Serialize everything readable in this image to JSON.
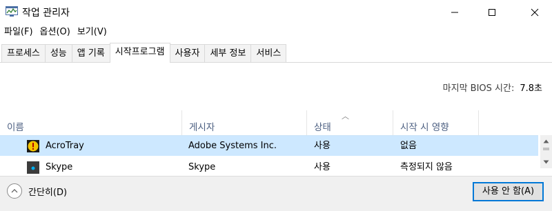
{
  "window": {
    "title": "작업 관리자"
  },
  "menu": {
    "file": "파일(F)",
    "options": "옵션(O)",
    "view": "보기(V)"
  },
  "tabs": [
    {
      "label": "프로세스"
    },
    {
      "label": "성능"
    },
    {
      "label": "앱 기록"
    },
    {
      "label": "시작프로그램",
      "active": true
    },
    {
      "label": "사용자"
    },
    {
      "label": "세부 정보"
    },
    {
      "label": "서비스"
    }
  ],
  "bios": {
    "label": "마지막 BIOS 시간:",
    "value": "7.8초"
  },
  "table": {
    "columns": [
      "이름",
      "게시자",
      "상태",
      "시작 시 영향"
    ],
    "sorted_column": "상태",
    "rows": [
      {
        "name": "AcroTray",
        "publisher": "Adobe Systems Inc.",
        "status": "사용",
        "impact": "없음",
        "icon": "acrotray-icon",
        "selected": true
      },
      {
        "name": "Skype",
        "publisher": "Skype",
        "status": "사용",
        "impact": "측정되지 않음",
        "icon": "skype-icon",
        "selected": false
      }
    ]
  },
  "footer": {
    "collapse_label": "간단히(D)",
    "disable_label": "사용 안 함(A)"
  },
  "colors": {
    "selected_row": "#cde8ff",
    "header_text": "#4d6082",
    "accent_border": "#0078d7"
  }
}
